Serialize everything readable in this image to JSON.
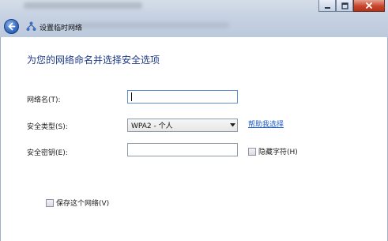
{
  "window": {
    "title": "设置临时网络",
    "controls": {
      "minimize_icon": "minimize-icon",
      "maximize_icon": "maximize-icon",
      "close_icon": "close-icon"
    }
  },
  "main": {
    "heading": "为您的网络命名并选择安全选项",
    "network_name": {
      "label": "网络名(T):",
      "value": ""
    },
    "security_type": {
      "label": "安全类型(S):",
      "selected": "WPA2 - 个人",
      "help_link": "帮助我选择"
    },
    "security_key": {
      "label": "安全密钥(E):",
      "value": "",
      "hide_chars_label": "隐藏字符(H)",
      "hide_chars_checked": false
    },
    "save_network": {
      "label": "保存这个网络(V)",
      "checked": false
    }
  },
  "colors": {
    "heading": "#1e3b8a",
    "link": "#1e5cc8",
    "titlebar": "#c7d2e2",
    "close_button": "#c8452b"
  }
}
